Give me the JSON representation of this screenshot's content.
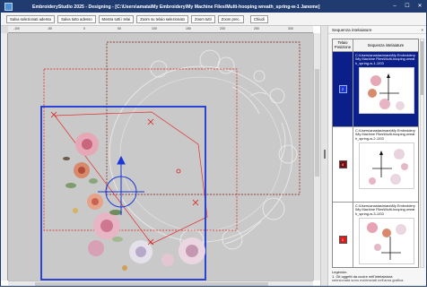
{
  "window": {
    "title": "EmbroideryStudio 2025 - Designing - [C:\\Users\\amata\\My Embroidery\\My Machine Files\\Multi-hooping wreath_spring-w-1     Janome]",
    "minimize_glyph": "–",
    "restore_glyph": "☐",
    "close_glyph": "✕"
  },
  "toolbar": {
    "buttons": [
      "Salva selezionati adesso",
      "Salva tutto adesso",
      "Mostra tutti i telai",
      "Zoom su telaio selezionato",
      "Zoom tutti",
      "Zoom prec.",
      "Chiudi"
    ]
  },
  "ruler": {
    "labels": [
      "-100",
      "-50",
      "0",
      "50",
      "100",
      "150",
      "200",
      "250",
      "300"
    ]
  },
  "panel": {
    "title": "Sequenza intelaiature",
    "close_glyph": "×",
    "col_position": "Telaio Posizione",
    "col_sequence": "Sequenza intelaiature",
    "rows": [
      {
        "number": "2",
        "color": "#1a36d6",
        "path": "C:\\Users\\anastasimara\\My Embroidery\\My Machine Files\\Multi-hooping wreath_spring-w-1.JJ03",
        "selected": true
      },
      {
        "number": "4",
        "color": "#7a0c0c",
        "path": "C:\\Users\\anastasimara\\My Embroidery\\My Machine Files\\Multi-hooping wreath_spring-w-2.JJ03",
        "selected": false
      },
      {
        "number": "1",
        "color": "#d61c1c",
        "path": "C:\\Users\\anastasimara\\My Embroidery\\My Machine Files\\Multi-hooping wreath_spring-w-3.JJ03",
        "selected": false
      }
    ],
    "legend_title": "Legenda:",
    "legend_line1": "1. Gli oggetti da cucire nell'intelaiatura",
    "legend_line2": "selezionata sono evidenziati nell'area grafica."
  },
  "colors": {
    "title_bar": "#1f3b6f",
    "hoop_selected": "#1a36d6",
    "hoop_red": "#d61c1c",
    "canvas_bg": "#c9c9c9"
  }
}
